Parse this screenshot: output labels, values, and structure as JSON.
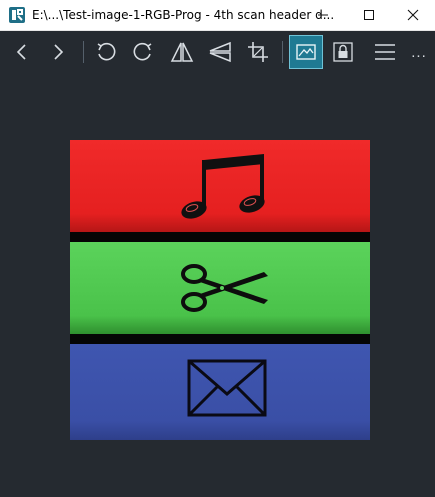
{
  "window": {
    "title": "E:\\...\\Test-image-1-RGB-Prog - 4th scan header d...",
    "controls": [
      "minimize",
      "maximize",
      "close"
    ]
  },
  "toolbar": {
    "buttons": [
      {
        "icon": "chevron-left-icon"
      },
      {
        "icon": "chevron-right-icon"
      },
      {
        "icon": "rotate-left-icon"
      },
      {
        "icon": "rotate-right-icon"
      },
      {
        "icon": "flip-horizontal-icon"
      },
      {
        "icon": "flip-vertical-icon"
      },
      {
        "icon": "crop-icon"
      },
      {
        "icon": "image-adjust-icon",
        "active": true
      },
      {
        "icon": "lock-icon"
      },
      {
        "icon": "menu-icon"
      }
    ],
    "more_label": "..."
  },
  "image": {
    "bands": [
      {
        "color": "#e52020",
        "symbol": "music-note-icon"
      },
      {
        "color": "#4ac24a",
        "symbol": "scissors-icon"
      },
      {
        "color": "#3a4fa6",
        "symbol": "envelope-icon"
      }
    ]
  },
  "colors": {
    "background": "#252a30",
    "accent": "#1f7a93",
    "titlebar": "#ffffff"
  }
}
